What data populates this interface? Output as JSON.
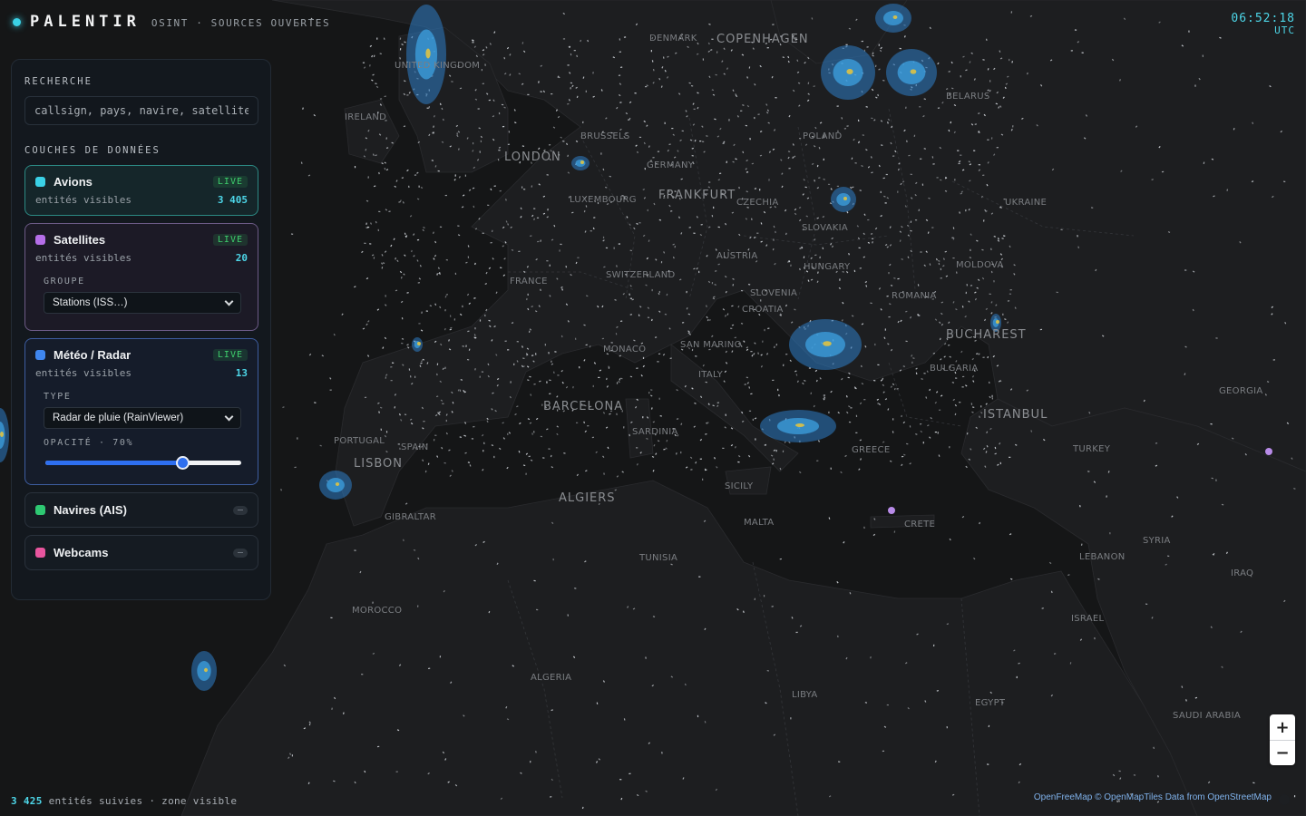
{
  "app": {
    "name": "PALENTIR",
    "subtitle": "OSINT · SOURCES OUVERTES"
  },
  "clock": {
    "time": "06:52:18",
    "zone": "UTC"
  },
  "search": {
    "label": "RECHERCHE",
    "placeholder": "callsign, pays, navire, satellite…"
  },
  "layers_label": "COUCHES DE DONNÉES",
  "layers": [
    {
      "name": "Avions",
      "status": "LIVE",
      "stat_label": "entités visibles",
      "count": "3 405",
      "color": "#3ad1e6"
    },
    {
      "name": "Satellites",
      "status": "LIVE",
      "stat_label": "entités visibles",
      "count": "20",
      "color": "#b56ee8",
      "group_label": "GROUPE",
      "group_value": "Stations (ISS…)"
    },
    {
      "name": "Météo / Radar",
      "status": "LIVE",
      "stat_label": "entités visibles",
      "count": "13",
      "color": "#3f86ef",
      "type_label": "TYPE",
      "type_value": "Radar de pluie (RainViewer)",
      "opacity_label": "OPACITÉ · 70%",
      "opacity": 0.7
    },
    {
      "name": "Navires (AIS)",
      "color": "#2ec872"
    },
    {
      "name": "Webcams",
      "color": "#e8559e"
    }
  ],
  "footer": {
    "count": "3 425",
    "text": "entités suivies · zone visible"
  },
  "zoom": {
    "in": "+",
    "out": "−"
  },
  "attribution": "OpenFreeMap © OpenMapTiles Data from OpenStreetMap",
  "map_labels": [
    "UNITED KINGDOM",
    "IRELAND",
    "LONDON",
    "COPENHAGEN",
    "DENMARK",
    "GERMANY",
    "FRANKFURT",
    "POLAND",
    "CZECHIA",
    "SLOVAKIA",
    "AUSTRIA",
    "HUNGARY",
    "SWITZERLAND",
    "FRANCE",
    "SPAIN",
    "PORTUGAL",
    "LISBON",
    "ITALY",
    "ROMANIA",
    "BUCHAREST",
    "BULGARIA",
    "ISTANBUL",
    "TURKEY",
    "GREECE",
    "ALGIERS",
    "TUNISIA",
    "MOROCCO",
    "ALGERIA",
    "LIBYA",
    "EGYPT",
    "UKRAINE",
    "MOLDOVA",
    "SYRIA",
    "LEBANON",
    "ISRAEL",
    "SAUDI ARABIA",
    "IRAQ",
    "GEORGIA",
    "BELARUS",
    "BARCELONA",
    "SARDINIA",
    "SICILY",
    "CRETE",
    "MALTA",
    "GIBRALTAR",
    "BRUSSELS",
    "LUXEMBOURG",
    "MONACO",
    "SAN MARINO",
    "CROATIA",
    "SLOVENIA"
  ]
}
